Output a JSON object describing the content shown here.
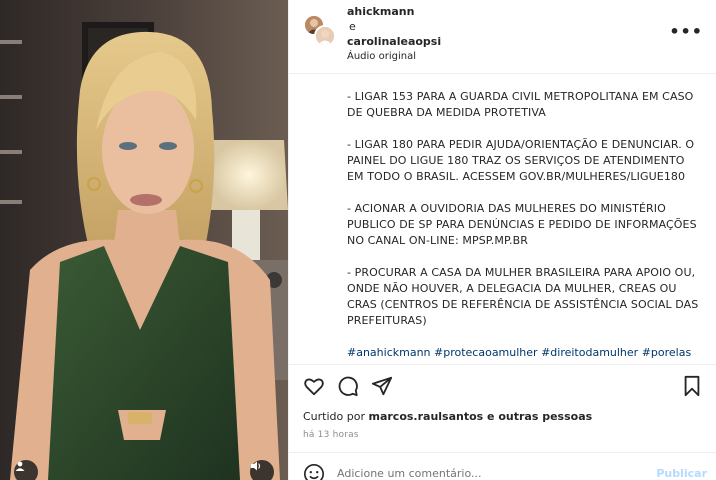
{
  "header": {
    "user1": "ahickmann",
    "conjunction": "e",
    "user2": "carolinaleaopsi",
    "audio": "Áudio original",
    "more_icon": "more-dots-icon"
  },
  "caption": {
    "paragraphs": [
      "- LIGAR 153 PARA A GUARDA CIVIL METROPOLITANA EM CASO DE QUEBRA DA MEDIDA PROTETIVA",
      "- LIGAR 180 PARA PEDIR AJUDA/ORIENTAÇÃO E DENUNCIAR. O PAINEL DO LIGUE 180 TRAZ OS SERVIÇOS DE ATENDIMENTO EM TODO O BRASIL. ACESSEM GOV.BR/MULHERES/LIGUE180",
      "- ACIONAR A OUVIDORIA DAS MULHERES DO MINISTÉRIO PUBLICO DE SP PARA DENÚNCIAS E PEDIDO DE INFORMAÇÕES NO CANAL ON-LINE: MPSP.MP.BR",
      "- PROCURAR A CASA DA MULHER BRASILEIRA PARA APOIO OU, ONDE NÃO HOUVER, A DELEGACIA DA MULHER, CREAS OU CRAS (CENTROS DE REFERÊNCIA DE ASSISTÊNCIA SOCIAL DAS PREFEITURAS)"
    ],
    "hashtags": "#anahickmann #protecaoamulher #direitodamulher #porelas"
  },
  "actions": {
    "like_icon": "heart-icon",
    "comment_icon": "comment-icon",
    "share_icon": "share-icon",
    "save_icon": "bookmark-icon"
  },
  "likes": {
    "prefix": "Curtido por ",
    "user": "marcos.raulsantos",
    "suffix": " e outras pessoas"
  },
  "timestamp": "há 13 horas",
  "comment": {
    "placeholder": "Adicione um comentário...",
    "publish": "Publicar"
  },
  "colors": {
    "link": "#00376b",
    "publish_disabled": "#b3dbff",
    "dress": "#2f4a2a"
  }
}
